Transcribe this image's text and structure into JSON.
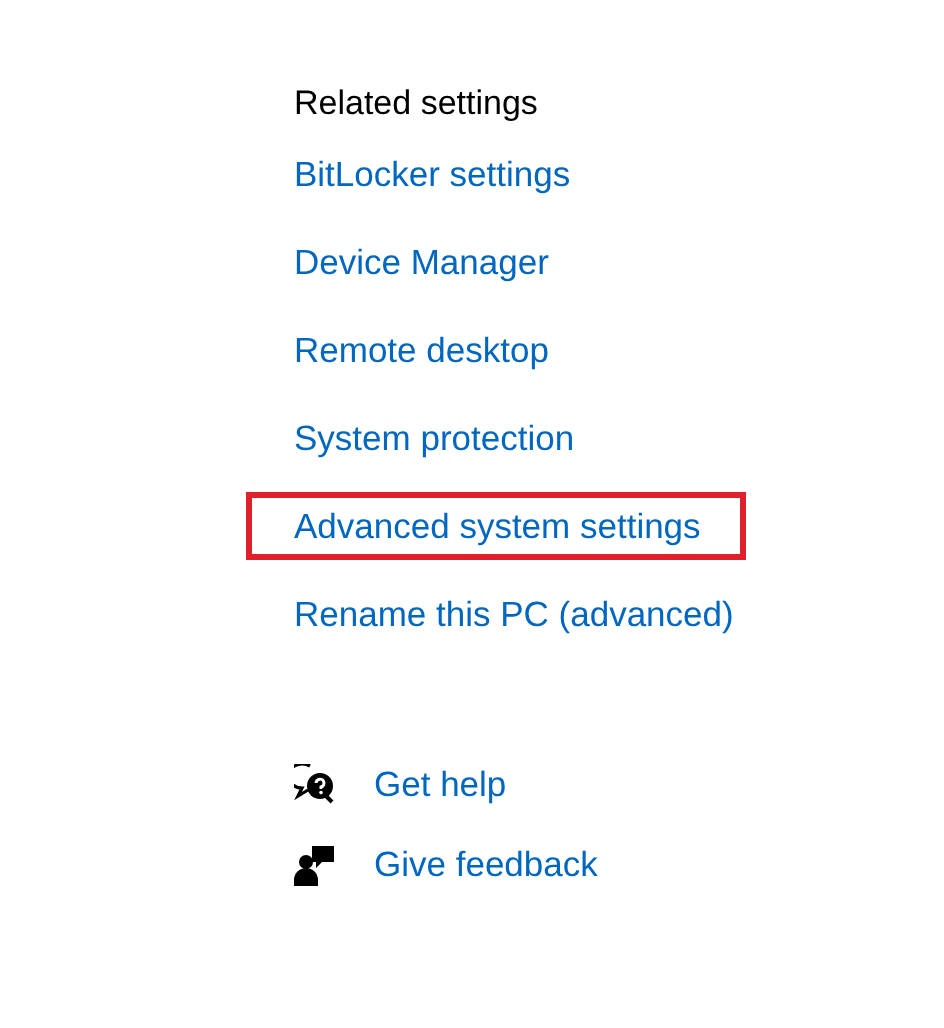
{
  "heading": "Related settings",
  "links": [
    {
      "label": "BitLocker settings",
      "highlighted": false
    },
    {
      "label": "Device Manager",
      "highlighted": false
    },
    {
      "label": "Remote desktop",
      "highlighted": false
    },
    {
      "label": "System protection",
      "highlighted": false
    },
    {
      "label": "Advanced system settings",
      "highlighted": true
    },
    {
      "label": "Rename this PC (advanced)",
      "highlighted": false
    }
  ],
  "support": [
    {
      "kind": "help",
      "label": "Get help"
    },
    {
      "kind": "feedback",
      "label": "Give feedback"
    }
  ]
}
